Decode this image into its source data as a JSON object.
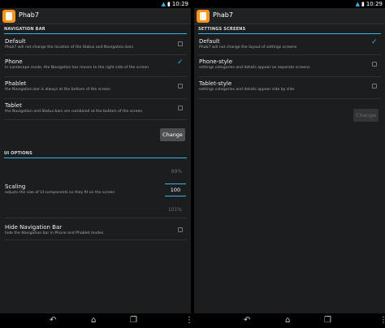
{
  "app": {
    "title": "Phab7",
    "accent": "#33b5e5",
    "icon_color": "#f7941d"
  },
  "status_bar": {
    "left_time": "10:29",
    "right_time": "10:29",
    "icons": [
      "wifi-icon",
      "battery-icon"
    ]
  },
  "left_screen": {
    "nav_bar_category": "NAVIGATION BAR",
    "nav_options": [
      {
        "title": "Default",
        "summary": "Phab7 will not change the location of the Status and Navigation bars",
        "checked": false
      },
      {
        "title": "Phone",
        "summary": "in Landscape mode, the Navigation bar moves to the right side of the screen",
        "checked": true
      },
      {
        "title": "Phablet",
        "summary": "the Navigation bar is always at the bottom of the screen",
        "checked": false
      },
      {
        "title": "Tablet",
        "summary": "the Navigation and Status bars are combined at the bottom of the screen",
        "checked": false
      }
    ],
    "change_button": "Change",
    "ui_category": "UI OPTIONS",
    "scaling": {
      "title": "Scaling",
      "summary": "adjusts the size of UI components so they fit on the screen",
      "prev": "99%",
      "current": "100",
      "next": "101%"
    },
    "hide_nav": {
      "title": "Hide Navigation Bar",
      "summary": "hide the Navigation bar in Phone and Phablet modes",
      "checked": false
    }
  },
  "right_screen": {
    "category": "SETTINGS SCREENS",
    "options": [
      {
        "title": "Default",
        "summary": "Phab7 will not change the layout of settings screens",
        "checked": true
      },
      {
        "title": "Phone-style",
        "summary": "settings categories and details appear on separate screens",
        "checked": false
      },
      {
        "title": "Tablet-style",
        "summary": "settings categories and details appear side by side",
        "checked": false
      }
    ],
    "change_button": "Change"
  },
  "nav_bar": {
    "buttons": [
      "back-icon",
      "home-icon",
      "recent-apps-icon",
      "overflow-menu-icon"
    ]
  }
}
